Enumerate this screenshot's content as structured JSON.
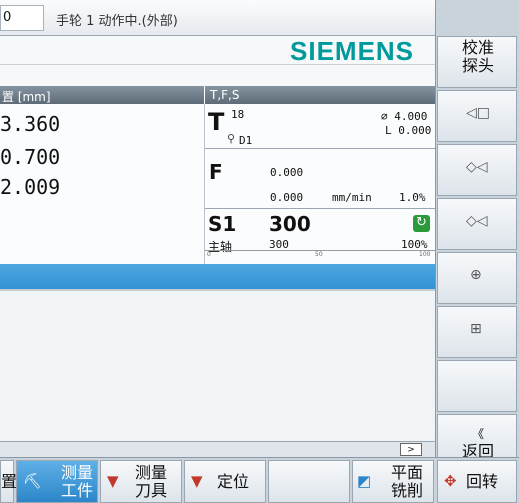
{
  "status": {
    "program_cell": "0",
    "message": "手轮 1 动作中.(外部)"
  },
  "brand": {
    "logo": "SIEMENS"
  },
  "position": {
    "header": "置 [mm]",
    "values": [
      "3.360",
      "0.700",
      "2.009"
    ]
  },
  "tfs": {
    "header": "T,F,S",
    "tool": {
      "letter": "T",
      "number": "18",
      "diameter": "⌀ 4.000",
      "length": "L 0.000",
      "edge": "D1"
    },
    "feed": {
      "letter": "F",
      "actual": "0.000",
      "programmed": "0.000",
      "unit": "mm/min",
      "override": "1.0%"
    },
    "spindle": {
      "label": "S1",
      "speed": "300",
      "name": "主轴",
      "programmed": "300",
      "override": "100%",
      "scale": [
        "0",
        "50",
        "100"
      ]
    }
  },
  "scroll": {
    "right_arrow": ">"
  },
  "vertical_softkeys": {
    "title": [
      "校准",
      "探头"
    ],
    "back": [
      "返回"
    ],
    "back_icon": "《"
  },
  "horizontal_softkeys": {
    "k1": "置",
    "k2": [
      "测量",
      "工件"
    ],
    "k3": [
      "测量",
      "刀具"
    ],
    "k4": "定位",
    "k5": [
      "平面",
      "铣削"
    ],
    "k6": "回转"
  },
  "colors": {
    "brand": "#009a9b",
    "header": "#5d6b78",
    "selection": "#3292d3",
    "active_softkey": "#2b86c9",
    "spindle_ok": "#2a9a3b"
  }
}
